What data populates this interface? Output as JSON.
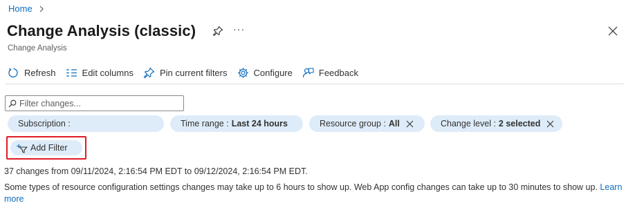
{
  "breadcrumb": {
    "home": "Home"
  },
  "page": {
    "title": "Change Analysis (classic)",
    "subtitle": "Change Analysis",
    "more": "···"
  },
  "toolbar": {
    "refresh": "Refresh",
    "edit_columns": "Edit columns",
    "pin_filters": "Pin current filters",
    "configure": "Configure",
    "feedback": "Feedback"
  },
  "filter": {
    "placeholder": "Filter changes..."
  },
  "pills": {
    "subscription": {
      "label": "Subscription :",
      "value": ""
    },
    "time_range": {
      "label": "Time range :",
      "value": "Last 24 hours"
    },
    "resource_group": {
      "label": "Resource group :",
      "value": "All"
    },
    "change_level": {
      "label": "Change level :",
      "value": "2 selected"
    }
  },
  "add_filter": "Add Filter",
  "summary": "37 changes from 09/11/2024, 2:16:54 PM EDT to 09/12/2024, 2:16:54 PM EDT.",
  "note": {
    "text": "Some types of resource configuration settings changes may take up to 6 hours to show up. Web App config changes can take up to 30 minutes to show up.",
    "link": "Learn more"
  },
  "colors": {
    "accent": "#0f6cbd",
    "pill_bg": "#deecf9",
    "highlight": "#e01b24"
  }
}
